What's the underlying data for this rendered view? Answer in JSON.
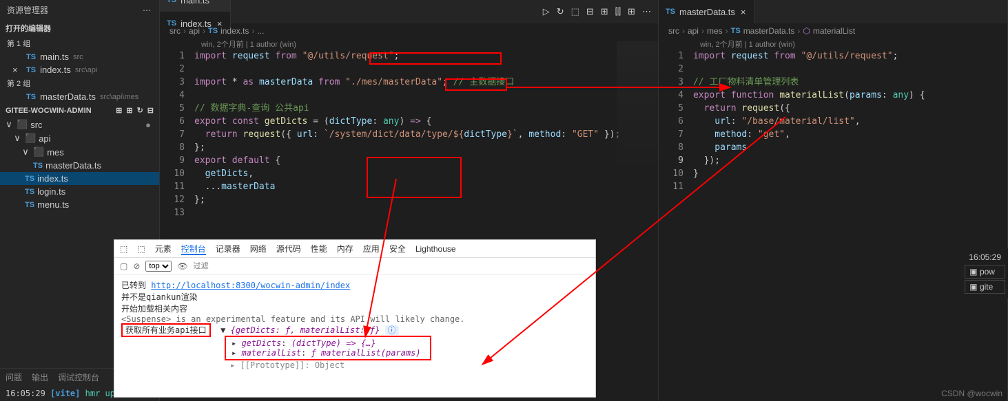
{
  "sidebar": {
    "title": "资源管理器",
    "openEditorsLabel": "打开的编辑器",
    "group1": "第 1 组",
    "group2": "第 2 组",
    "openFiles": [
      {
        "name": "main.ts",
        "path": "src",
        "close": ""
      },
      {
        "name": "index.ts",
        "path": "src\\api",
        "close": "×"
      }
    ],
    "openFiles2": [
      {
        "name": "masterData.ts",
        "path": "src\\api\\mes",
        "close": ""
      }
    ],
    "projectName": "GITEE-WOCWIN-ADMIN",
    "tree": {
      "src": "src",
      "api": "api",
      "mes": "mes",
      "masterData": "masterData.ts",
      "index": "index.ts",
      "login": "login.ts",
      "menu": "menu.ts"
    },
    "bottomTabs": [
      "问题",
      "输出",
      "调试控制台"
    ],
    "terminal": {
      "time": "16:05:29",
      "vite": "[vite]",
      "msg": "hmr up"
    }
  },
  "editor1": {
    "tabs": [
      {
        "name": "main.ts",
        "active": false
      },
      {
        "name": "index.ts",
        "active": true
      }
    ],
    "runIcons": [
      "▷",
      "↻",
      "⬚",
      "⊟",
      "⊞",
      "⫿⫿",
      "⊞",
      "⋯"
    ],
    "crumbs": [
      "src",
      "api",
      "index.ts",
      "..."
    ],
    "codelens": "win, 2个月前 | 1 author (win)",
    "lines": [
      {
        "n": "1",
        "html": "<span class='kw'>import</span> <span class='va'>request</span> <span class='kw'>from</span> <span class='st'>\"@/utils/request\"</span>;"
      },
      {
        "n": "2",
        "html": ""
      },
      {
        "n": "3",
        "html": "<span class='kw'>import</span> <span class='pu'>*</span> <span class='kw'>as</span> <span class='va'>masterData</span> <span class='kw'>from</span> <span class='st'>\"./mes/masterData\"</span>; <span class='cm'>// 主数据接口</span>"
      },
      {
        "n": "4",
        "html": ""
      },
      {
        "n": "5",
        "html": "<span class='cm'>// 数据字典-查询 公共api</span>"
      },
      {
        "n": "6",
        "html": "<span class='kw'>export</span> <span class='kw'>const</span> <span class='fn'>getDicts</span> = (<span class='va'>dictType</span>: <span class='ty'>any</span>) <span class='kw'>=&gt;</span> {"
      },
      {
        "n": "7",
        "html": "  <span class='kw'>return</span> <span class='fn'>request</span>({ <span class='va'>url</span>: <span class='st'>`/system/dict/data/type/${</span><span class='va'>dictType</span><span class='st'>}`</span>, <span class='va'>method</span>: <span class='st'>\"GET\"</span> });"
      },
      {
        "n": "8",
        "html": "};"
      },
      {
        "n": "9",
        "html": "<span class='kw'>export</span> <span class='kw'>default</span> {"
      },
      {
        "n": "10",
        "html": "  <span class='va'>getDicts</span>,"
      },
      {
        "n": "11",
        "html": "  ...<span class='va'>masterData</span>"
      },
      {
        "n": "12",
        "html": "};"
      },
      {
        "n": "13",
        "html": ""
      }
    ]
  },
  "editor2": {
    "tabs": [
      {
        "name": "masterData.ts",
        "active": true
      }
    ],
    "crumbs": [
      "src",
      "api",
      "mes",
      "masterData.ts",
      "materialList"
    ],
    "codelens": "win, 2个月前 | 1 author (win)",
    "lines": [
      {
        "n": "1",
        "html": "<span class='kw'>import</span> <span class='va'>request</span> <span class='kw'>from</span> <span class='st'>\"@/utils/request\"</span>;"
      },
      {
        "n": "2",
        "html": ""
      },
      {
        "n": "3",
        "html": "<span class='cm'>// 工厂物料清单管理列表</span>"
      },
      {
        "n": "4",
        "html": "<span class='kw'>export</span> <span class='kw'>function</span> <span class='fn'>materialList</span>(<span class='va'>params</span>: <span class='ty'>any</span>) {"
      },
      {
        "n": "5",
        "html": "  <span class='kw'>return</span> <span class='fn'>request</span>({"
      },
      {
        "n": "6",
        "html": "    <span class='va'>url</span>: <span class='st'>\"/base/material/list\"</span>,"
      },
      {
        "n": "7",
        "html": "    <span class='va'>method</span>: <span class='st'>\"get\"</span>,"
      },
      {
        "n": "8",
        "html": "    <span class='va'>params</span>"
      },
      {
        "n": "9",
        "html": "  });",
        "hl": true
      },
      {
        "n": "10",
        "html": "}"
      },
      {
        "n": "11",
        "html": ""
      }
    ],
    "rightTime": "16:05:29",
    "rightTerms": [
      "pow",
      "gite"
    ]
  },
  "devtools": {
    "mainTabs": [
      "元素",
      "控制台",
      "记录器",
      "网络",
      "源代码",
      "性能",
      "内存",
      "应用",
      "安全",
      "Lighthouse"
    ],
    "activeTab": "控制台",
    "topSelect": "top",
    "filter": "过滤",
    "navMsg": "已转到",
    "navUrl": "http://localhost:8300/wocwin-admin/index",
    "line2": "并不是qiankun渲染",
    "line3": "开始加载相关内容",
    "line4": "<Suspense> is an experimental feature and its API will likely change.",
    "label": "获取所有业务api接口",
    "objSummary": "{getDicts: ƒ, materialList: ƒ}",
    "prop1": "getDicts",
    "prop1v": "(dictType) => {…}",
    "prop2": "materialList",
    "prop2v": "ƒ materialList(params)",
    "proto": "[[Prototype]]: Object"
  },
  "watermark": "CSDN @wocwin"
}
